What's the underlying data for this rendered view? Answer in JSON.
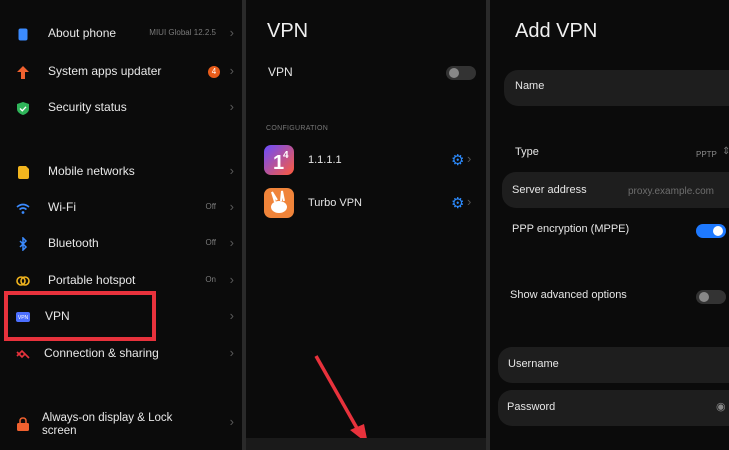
{
  "settings": {
    "items": [
      {
        "label": "About phone",
        "value": "MIUI Global 12.2.5",
        "icon": "info-icon"
      },
      {
        "label": "System apps updater",
        "badge": "4",
        "icon": "arrow-up-icon"
      },
      {
        "label": "Security status",
        "icon": "shield-check-icon"
      },
      {
        "label": "Mobile networks",
        "icon": "sim-icon"
      },
      {
        "label": "Wi-Fi",
        "value": "Off",
        "icon": "wifi-icon"
      },
      {
        "label": "Bluetooth",
        "value": "Off",
        "icon": "bluetooth-icon"
      },
      {
        "label": "Portable hotspot",
        "value": "On",
        "icon": "hotspot-icon"
      },
      {
        "label": "VPN",
        "icon": "vpn-icon"
      },
      {
        "label": "Connection & sharing",
        "icon": "share-icon"
      },
      {
        "label": "Always-on display & Lock screen",
        "icon": "lock-icon"
      }
    ]
  },
  "vpn": {
    "title": "VPN",
    "toggle_label": "VPN",
    "toggle_on": false,
    "section": "CONFIGURATION",
    "entries": [
      {
        "label": "1.1.1.1",
        "icon": "cloudflare-1111-icon"
      },
      {
        "label": "Turbo VPN",
        "icon": "turbo-vpn-rabbit-icon"
      }
    ]
  },
  "add_vpn": {
    "title": "Add VPN",
    "name_label": "Name",
    "type_label": "Type",
    "type_value": "PPTP",
    "server_label": "Server address",
    "server_placeholder": "proxy.example.com",
    "ppp_label": "PPP encryption (MPPE)",
    "ppp_on": true,
    "advanced_label": "Show advanced options",
    "advanced_on": false,
    "username_label": "Username",
    "password_label": "Password"
  },
  "colors": {
    "accent": "#2d8cff",
    "highlight": "#e8323c",
    "panel_bg": "#0b0b0b",
    "field_bg": "#1e1e1e"
  }
}
